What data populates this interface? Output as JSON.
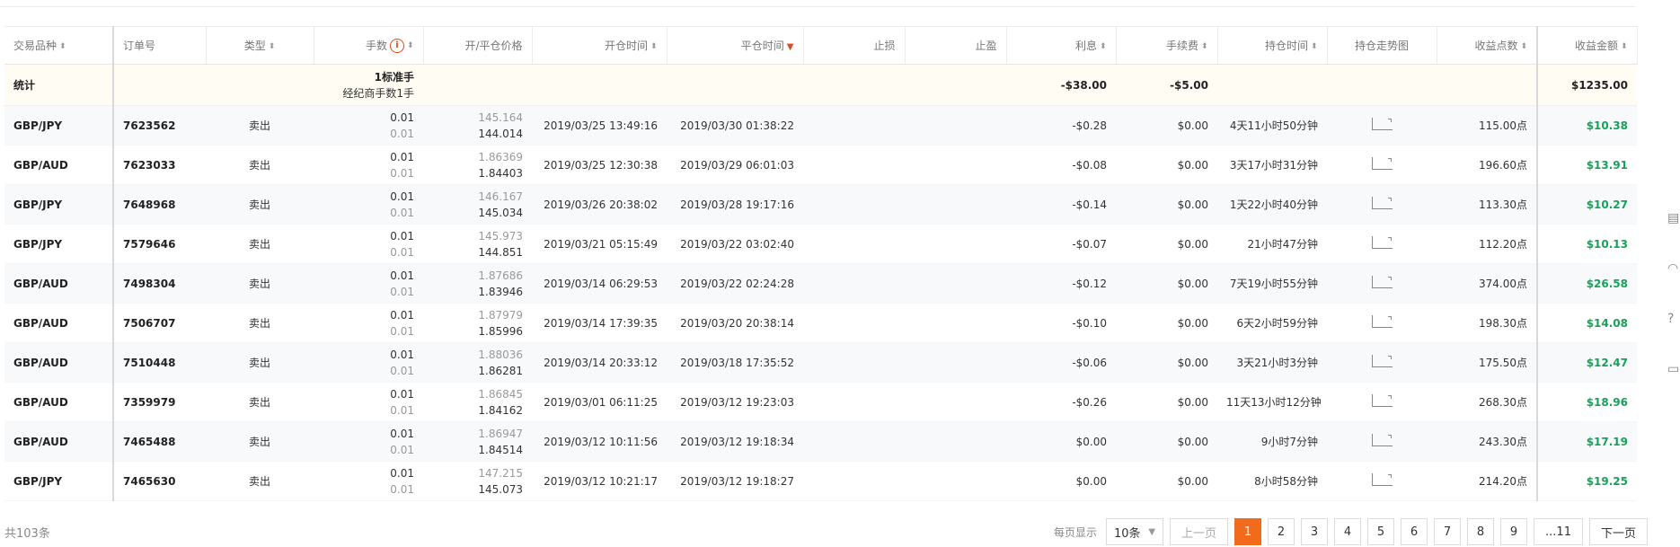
{
  "headers": {
    "symbol": "交易品种",
    "order_no": "订单号",
    "type": "类型",
    "lots": "手数",
    "open_close_price": "开/平仓价格",
    "open_time": "开仓时间",
    "close_time": "平仓时间",
    "stop_loss": "止损",
    "take_profit": "止盈",
    "interest": "利息",
    "fee": "手续费",
    "hold_time": "持仓时间",
    "trend_chart": "持仓走势图",
    "profit_points": "收益点数",
    "profit_amount": "收益金额"
  },
  "stats": {
    "label": "统计",
    "lots_line1": "1标准手",
    "lots_line2": "经纪商手数1手",
    "interest": "-$38.00",
    "fee": "-$5.00",
    "profit_amount": "$1235.00"
  },
  "rows": [
    {
      "symbol": "GBP/JPY",
      "order": "7623562",
      "type": "卖出",
      "lot_open": "0.01",
      "lot_close": "0.01",
      "price_open": "145.164",
      "price_close": "144.014",
      "open_time": "2019/03/25 13:49:16",
      "close_time": "2019/03/30 01:38:22",
      "interest": "-$0.28",
      "fee": "$0.00",
      "hold": "4天11小时50分钟",
      "points": "115.00点",
      "amount": "$10.38"
    },
    {
      "symbol": "GBP/AUD",
      "order": "7623033",
      "type": "卖出",
      "lot_open": "0.01",
      "lot_close": "0.01",
      "price_open": "1.86369",
      "price_close": "1.84403",
      "open_time": "2019/03/25 12:30:38",
      "close_time": "2019/03/29 06:01:03",
      "interest": "-$0.08",
      "fee": "$0.00",
      "hold": "3天17小时31分钟",
      "points": "196.60点",
      "amount": "$13.91"
    },
    {
      "symbol": "GBP/JPY",
      "order": "7648968",
      "type": "卖出",
      "lot_open": "0.01",
      "lot_close": "0.01",
      "price_open": "146.167",
      "price_close": "145.034",
      "open_time": "2019/03/26 20:38:02",
      "close_time": "2019/03/28 19:17:16",
      "interest": "-$0.14",
      "fee": "$0.00",
      "hold": "1天22小时40分钟",
      "points": "113.30点",
      "amount": "$10.27"
    },
    {
      "symbol": "GBP/JPY",
      "order": "7579646",
      "type": "卖出",
      "lot_open": "0.01",
      "lot_close": "0.01",
      "price_open": "145.973",
      "price_close": "144.851",
      "open_time": "2019/03/21 05:15:49",
      "close_time": "2019/03/22 03:02:40",
      "interest": "-$0.07",
      "fee": "$0.00",
      "hold": "21小时47分钟",
      "points": "112.20点",
      "amount": "$10.13"
    },
    {
      "symbol": "GBP/AUD",
      "order": "7498304",
      "type": "卖出",
      "lot_open": "0.01",
      "lot_close": "0.01",
      "price_open": "1.87686",
      "price_close": "1.83946",
      "open_time": "2019/03/14 06:29:53",
      "close_time": "2019/03/22 02:24:28",
      "interest": "-$0.12",
      "fee": "$0.00",
      "hold": "7天19小时55分钟",
      "points": "374.00点",
      "amount": "$26.58"
    },
    {
      "symbol": "GBP/AUD",
      "order": "7506707",
      "type": "卖出",
      "lot_open": "0.01",
      "lot_close": "0.01",
      "price_open": "1.87979",
      "price_close": "1.85996",
      "open_time": "2019/03/14 17:39:35",
      "close_time": "2019/03/20 20:38:14",
      "interest": "-$0.10",
      "fee": "$0.00",
      "hold": "6天2小时59分钟",
      "points": "198.30点",
      "amount": "$14.08"
    },
    {
      "symbol": "GBP/AUD",
      "order": "7510448",
      "type": "卖出",
      "lot_open": "0.01",
      "lot_close": "0.01",
      "price_open": "1.88036",
      "price_close": "1.86281",
      "open_time": "2019/03/14 20:33:12",
      "close_time": "2019/03/18 17:35:52",
      "interest": "-$0.06",
      "fee": "$0.00",
      "hold": "3天21小时3分钟",
      "points": "175.50点",
      "amount": "$12.47"
    },
    {
      "symbol": "GBP/AUD",
      "order": "7359979",
      "type": "卖出",
      "lot_open": "0.01",
      "lot_close": "0.01",
      "price_open": "1.86845",
      "price_close": "1.84162",
      "open_time": "2019/03/01 06:11:25",
      "close_time": "2019/03/12 19:23:03",
      "interest": "-$0.26",
      "fee": "$0.00",
      "hold": "11天13小时12分钟",
      "points": "268.30点",
      "amount": "$18.96"
    },
    {
      "symbol": "GBP/AUD",
      "order": "7465488",
      "type": "卖出",
      "lot_open": "0.01",
      "lot_close": "0.01",
      "price_open": "1.86947",
      "price_close": "1.84514",
      "open_time": "2019/03/12 10:11:56",
      "close_time": "2019/03/12 19:18:34",
      "interest": "$0.00",
      "fee": "$0.00",
      "hold": "9小时7分钟",
      "points": "243.30点",
      "amount": "$17.19"
    },
    {
      "symbol": "GBP/JPY",
      "order": "7465630",
      "type": "卖出",
      "lot_open": "0.01",
      "lot_close": "0.01",
      "price_open": "147.215",
      "price_close": "145.073",
      "open_time": "2019/03/12 10:21:17",
      "close_time": "2019/03/12 19:18:27",
      "interest": "$0.00",
      "fee": "$0.00",
      "hold": "8小时58分钟",
      "points": "214.20点",
      "amount": "$19.25"
    }
  ],
  "footer": {
    "total": "共103条",
    "per_page_label": "每页显示",
    "per_page_value": "10条",
    "prev": "上一页",
    "next": "下一页",
    "pages": [
      "1",
      "2",
      "3",
      "4",
      "5",
      "6",
      "7",
      "8",
      "9",
      "...11"
    ]
  },
  "colors": {
    "accent": "#f26a1b",
    "profit": "#19a05a",
    "sort_active": "#e8471c"
  }
}
